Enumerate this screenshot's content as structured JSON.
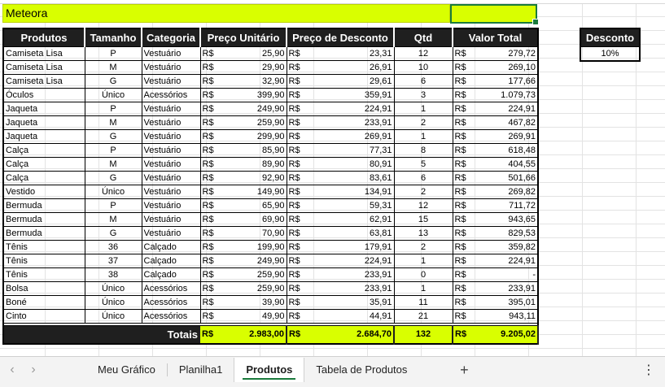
{
  "title": "Meteora",
  "headers": [
    "Produtos",
    "Tamanho",
    "Categoria",
    "Preço Unitário",
    "Preço de Desconto",
    "Qtd",
    "Valor Total"
  ],
  "currency": "R$",
  "rows": [
    {
      "produto": "Camiseta Lisa",
      "tamanho": "P",
      "categoria": "Vestuário",
      "preco": "25,90",
      "desconto": "23,31",
      "qtd": "12",
      "total": "279,72"
    },
    {
      "produto": "Camiseta Lisa",
      "tamanho": "M",
      "categoria": "Vestuário",
      "preco": "29,90",
      "desconto": "26,91",
      "qtd": "10",
      "total": "269,10"
    },
    {
      "produto": "Camiseta Lisa",
      "tamanho": "G",
      "categoria": "Vestuário",
      "preco": "32,90",
      "desconto": "29,61",
      "qtd": "6",
      "total": "177,66"
    },
    {
      "produto": "Óculos",
      "tamanho": "Único",
      "categoria": "Acessórios",
      "preco": "399,90",
      "desconto": "359,91",
      "qtd": "3",
      "total": "1.079,73"
    },
    {
      "produto": "Jaqueta",
      "tamanho": "P",
      "categoria": "Vestuário",
      "preco": "249,90",
      "desconto": "224,91",
      "qtd": "1",
      "total": "224,91"
    },
    {
      "produto": "Jaqueta",
      "tamanho": "M",
      "categoria": "Vestuário",
      "preco": "259,90",
      "desconto": "233,91",
      "qtd": "2",
      "total": "467,82"
    },
    {
      "produto": "Jaqueta",
      "tamanho": "G",
      "categoria": "Vestuário",
      "preco": "299,90",
      "desconto": "269,91",
      "qtd": "1",
      "total": "269,91"
    },
    {
      "produto": "Calça",
      "tamanho": "P",
      "categoria": "Vestuário",
      "preco": "85,90",
      "desconto": "77,31",
      "qtd": "8",
      "total": "618,48"
    },
    {
      "produto": "Calça",
      "tamanho": "M",
      "categoria": "Vestuário",
      "preco": "89,90",
      "desconto": "80,91",
      "qtd": "5",
      "total": "404,55"
    },
    {
      "produto": "Calça",
      "tamanho": "G",
      "categoria": "Vestuário",
      "preco": "92,90",
      "desconto": "83,61",
      "qtd": "6",
      "total": "501,66"
    },
    {
      "produto": "Vestido",
      "tamanho": "Único",
      "categoria": "Vestuário",
      "preco": "149,90",
      "desconto": "134,91",
      "qtd": "2",
      "total": "269,82"
    },
    {
      "produto": "Bermuda",
      "tamanho": "P",
      "categoria": "Vestuário",
      "preco": "65,90",
      "desconto": "59,31",
      "qtd": "12",
      "total": "711,72"
    },
    {
      "produto": "Bermuda",
      "tamanho": "M",
      "categoria": "Vestuário",
      "preco": "69,90",
      "desconto": "62,91",
      "qtd": "15",
      "total": "943,65"
    },
    {
      "produto": "Bermuda",
      "tamanho": "G",
      "categoria": "Vestuário",
      "preco": "70,90",
      "desconto": "63,81",
      "qtd": "13",
      "total": "829,53"
    },
    {
      "produto": "Tênis",
      "tamanho": "36",
      "categoria": "Calçado",
      "preco": "199,90",
      "desconto": "179,91",
      "qtd": "2",
      "total": "359,82"
    },
    {
      "produto": "Tênis",
      "tamanho": "37",
      "categoria": "Calçado",
      "preco": "249,90",
      "desconto": "224,91",
      "qtd": "1",
      "total": "224,91"
    },
    {
      "produto": "Tênis",
      "tamanho": "38",
      "categoria": "Calçado",
      "preco": "259,90",
      "desconto": "233,91",
      "qtd": "0",
      "total": "-"
    },
    {
      "produto": "Bolsa",
      "tamanho": "Único",
      "categoria": "Acessórios",
      "preco": "259,90",
      "desconto": "233,91",
      "qtd": "1",
      "total": "233,91"
    },
    {
      "produto": "Boné",
      "tamanho": "Único",
      "categoria": "Acessórios",
      "preco": "39,90",
      "desconto": "35,91",
      "qtd": "11",
      "total": "395,01"
    },
    {
      "produto": "Cinto",
      "tamanho": "Único",
      "categoria": "Acessórios",
      "preco": "49,90",
      "desconto": "44,91",
      "qtd": "21",
      "total": "943,11"
    }
  ],
  "totals": {
    "label": "Totais",
    "preco": "2.983,00",
    "desconto": "2.684,70",
    "qtd": "132",
    "total": "9.205,02"
  },
  "discount": {
    "header": "Desconto",
    "value": "10%"
  },
  "tabs": [
    {
      "label": "Meu Gráfico",
      "active": false
    },
    {
      "label": "Planilha1",
      "active": false
    },
    {
      "label": "Produtos",
      "active": true
    },
    {
      "label": "Tabela de Produtos",
      "active": false
    }
  ],
  "colors": {
    "highlight": "#d9ff00",
    "header_bg": "#1f1f1f",
    "selection": "#1a7a3c"
  }
}
